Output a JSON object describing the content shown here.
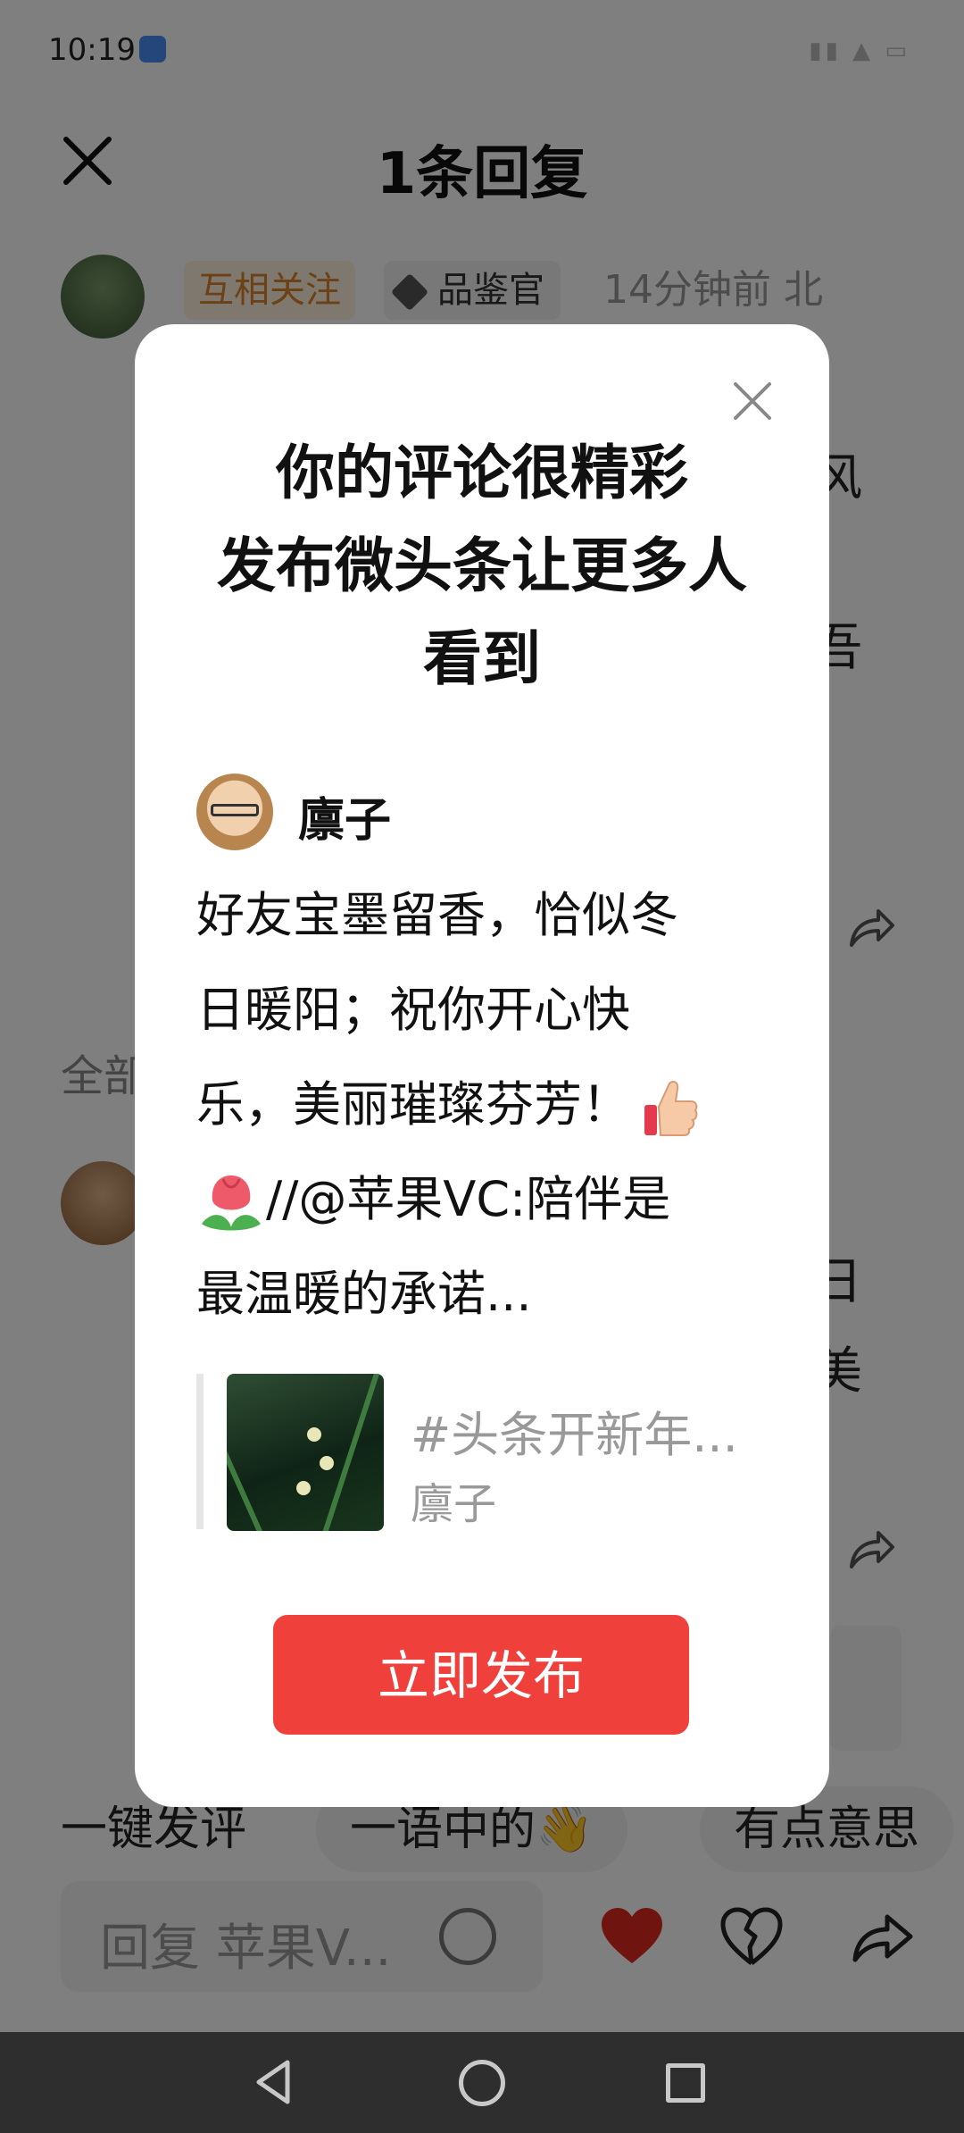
{
  "status_bar": {
    "time": "10:19",
    "sys_icons": "▮▮ ▲ ▭"
  },
  "header": {
    "title": "1条回复"
  },
  "comment": {
    "badge_follow": "互相关注",
    "badge_expert": "品鉴官",
    "meta": "14分钟前 北",
    "peek_lines": [
      "风",
      "吾"
    ]
  },
  "section": {
    "all_label": "全部"
  },
  "second_comment": {
    "peek_lines": [
      "日",
      "美"
    ]
  },
  "quick_replies": [
    "一键发评",
    "一语中的👋",
    "有点意思"
  ],
  "reply_box": {
    "placeholder": "回复 苹果V..."
  },
  "modal": {
    "title_lines": [
      "你的评论很精彩",
      "发布微头条让更多人",
      "看到"
    ],
    "author": "廪子",
    "body_lines": [
      "好友宝墨留香，恰似冬",
      "日暖阳；祝你开心快",
      "乐，美丽璀璨芬芳！",
      "//@苹果VC:陪伴是",
      "最温暖的承诺..."
    ],
    "quote": {
      "title": "#头条开新年...",
      "author": "廪子"
    },
    "publish_label": "立即发布"
  },
  "icons": [
    "close-icon",
    "share-icon",
    "smile-icon",
    "heart-icon",
    "broken-heart-icon",
    "thumbs-up-emoji",
    "tulip-emoji",
    "back-icon",
    "home-icon",
    "recents-icon"
  ],
  "colors": {
    "accent_red": "#f0403c",
    "follow_orange": "#d9822b",
    "overlay": "rgba(0,0,0,0.5)"
  }
}
